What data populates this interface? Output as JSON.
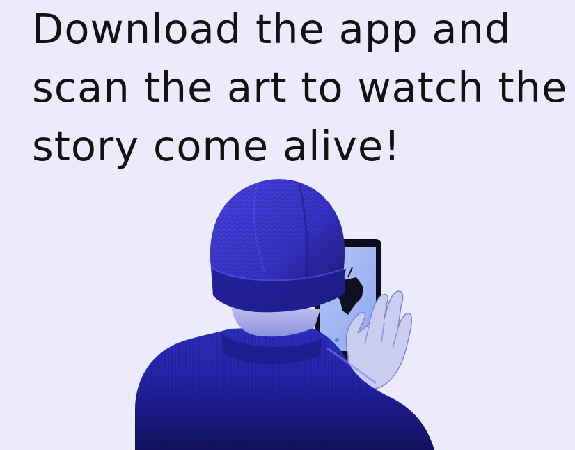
{
  "headline": {
    "lines": [
      "Download the app and",
      "scan the art to watch the",
      "story come alive!"
    ]
  },
  "colors": {
    "background": "#ecebfb",
    "text": "#121212",
    "hat": "#3a35c8",
    "sweater": "#2b2bb0",
    "shadow": "#0b0b3a"
  }
}
